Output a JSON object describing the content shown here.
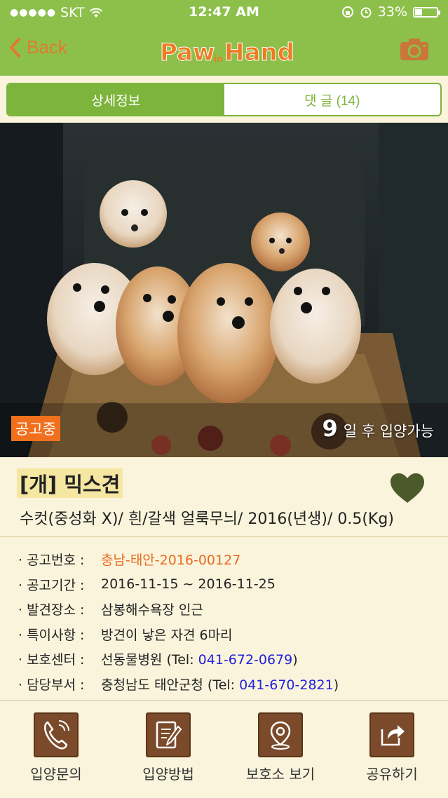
{
  "status_bar": {
    "carrier": "SKT",
    "time": "12:47 AM",
    "battery": "33%"
  },
  "nav": {
    "back_label": "Back",
    "logo_text": "Paw in Hand"
  },
  "segments": [
    {
      "label": "상세정보"
    },
    {
      "label": "댓 글 (14)"
    }
  ],
  "photo": {
    "status_tag": "공고중",
    "days_number": "9",
    "days_text": "일 후 입양가능"
  },
  "animal": {
    "title": "[개] 믹스견",
    "description": "수컷(중성화 X)/ 흰/갈색 얼룩무늬/ 2016(년생)/ 0.5(Kg)"
  },
  "info": [
    {
      "label": "· 공고번호 :",
      "value": "충남-태안-2016-00127"
    },
    {
      "label": "· 공고기간 :",
      "value": "2016-11-15 ~ 2016-11-25"
    },
    {
      "label": "· 발견장소 :",
      "value": "삼봉해수욕장 인근"
    },
    {
      "label": "· 특이사항 :",
      "value": "방견이 낳은 자견 6마리"
    },
    {
      "label": "· 보호센터 :",
      "value": "선동물병원 (Tel: ",
      "phone": "041-672-0679",
      "suffix": ")"
    },
    {
      "label": "· 담당부서 :",
      "value": "충청남도 태안군청 (Tel: ",
      "phone": "041-670-2821",
      "suffix": ")"
    }
  ],
  "tabs": [
    {
      "label": "입양문의",
      "icon": "phone-icon"
    },
    {
      "label": "입양방법",
      "icon": "document-edit-icon"
    },
    {
      "label": "보호소 보기",
      "icon": "map-pin-icon"
    },
    {
      "label": "공유하기",
      "icon": "share-icon"
    }
  ],
  "colors": {
    "header": "#8cc04a",
    "accent_orange": "#e07b2f",
    "segment_green": "#7db43c",
    "icon_brown": "#7a4a2a",
    "heart": "#4a5a2a"
  }
}
